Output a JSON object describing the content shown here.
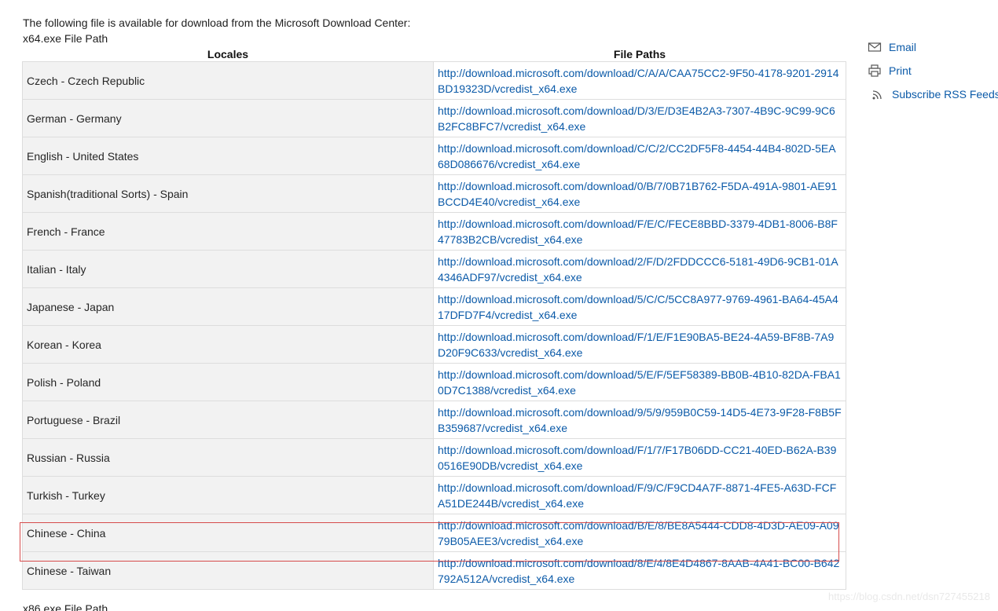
{
  "intro": {
    "line1": "The following file is available for download from the Microsoft Download Center:",
    "line2": "x64.exe File Path"
  },
  "table": {
    "headers": [
      "Locales",
      "File Paths"
    ],
    "rows": [
      {
        "locale": "Czech - Czech Republic",
        "path": "http://download.microsoft.com/download/C/A/A/CAA75CC2-9F50-4178-9201-2914BD19323D/vcredist_x64.exe"
      },
      {
        "locale": "German - Germany",
        "path": "http://download.microsoft.com/download/D/3/E/D3E4B2A3-7307-4B9C-9C99-9C6B2FC8BFC7/vcredist_x64.exe"
      },
      {
        "locale": "English - United States",
        "path": "http://download.microsoft.com/download/C/C/2/CC2DF5F8-4454-44B4-802D-5EA68D086676/vcredist_x64.exe"
      },
      {
        "locale": "Spanish(traditional Sorts) - Spain",
        "path": "http://download.microsoft.com/download/0/B/7/0B71B762-F5DA-491A-9801-AE91BCCD4E40/vcredist_x64.exe"
      },
      {
        "locale": "French - France",
        "path": "http://download.microsoft.com/download/F/E/C/FECE8BBD-3379-4DB1-8006-B8F47783B2CB/vcredist_x64.exe"
      },
      {
        "locale": "Italian - Italy",
        "path": "http://download.microsoft.com/download/2/F/D/2FDDCCC6-5181-49D6-9CB1-01A4346ADF97/vcredist_x64.exe"
      },
      {
        "locale": "Japanese - Japan",
        "path": "http://download.microsoft.com/download/5/C/C/5CC8A977-9769-4961-BA64-45A417DFD7F4/vcredist_x64.exe"
      },
      {
        "locale": "Korean - Korea",
        "path": "http://download.microsoft.com/download/F/1/E/F1E90BA5-BE24-4A59-BF8B-7A9D20F9C633/vcredist_x64.exe"
      },
      {
        "locale": "Polish - Poland",
        "path": "http://download.microsoft.com/download/5/E/F/5EF58389-BB0B-4B10-82DA-FBA10D7C1388/vcredist_x64.exe"
      },
      {
        "locale": "Portuguese - Brazil",
        "path": "http://download.microsoft.com/download/9/5/9/959B0C59-14D5-4E73-9F28-F8B5FB359687/vcredist_x64.exe"
      },
      {
        "locale": "Russian - Russia",
        "path": "http://download.microsoft.com/download/F/1/7/F17B06DD-CC21-40ED-B62A-B390516E90DB/vcredist_x64.exe"
      },
      {
        "locale": "Turkish - Turkey",
        "path": "http://download.microsoft.com/download/F/9/C/F9CD4A7F-8871-4FE5-A63D-FCFA51DE244B/vcredist_x64.exe"
      },
      {
        "locale": "Chinese - China",
        "path": "http://download.microsoft.com/download/B/E/8/BE8A5444-CDD8-4D3D-AE09-A0979B05AEE3/vcredist_x64.exe"
      },
      {
        "locale": "Chinese - Taiwan",
        "path": "http://download.microsoft.com/download/8/E/4/8E4D4867-8AAB-4A41-BC00-B642792A512A/vcredist_x64.exe"
      }
    ]
  },
  "footer": {
    "next_section": "x86.exe File Path"
  },
  "side_actions": {
    "email": {
      "label": "Email",
      "icon": "envelope-icon"
    },
    "print": {
      "label": "Print",
      "icon": "printer-icon"
    },
    "rss": {
      "label": "Subscribe RSS Feeds",
      "icon": "rss-icon"
    }
  },
  "watermark": {
    "text": "https://blog.csdn.net/dsn727455218"
  },
  "colors": {
    "link": "#0b5aa8",
    "locale_bg": "#f2f2f2",
    "highlight": "#d64c4c"
  }
}
